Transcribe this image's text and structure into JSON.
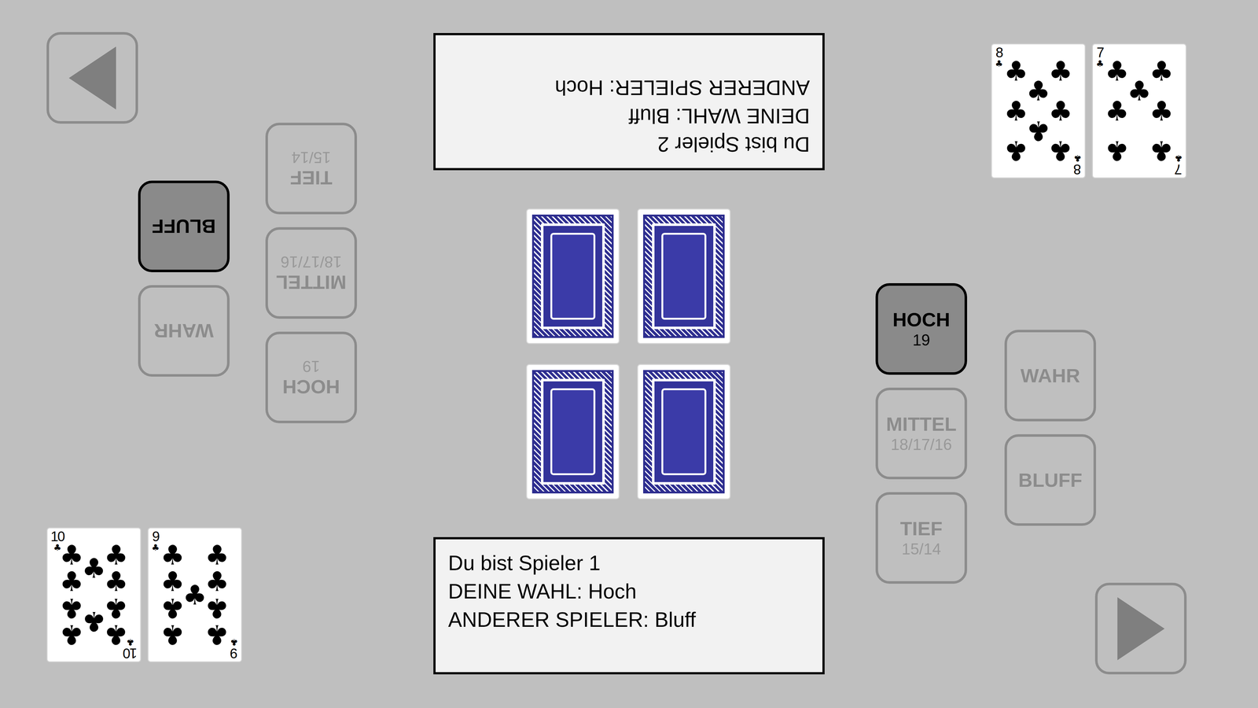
{
  "players": [
    {
      "status_lines": [
        "Du bist Spieler 1",
        "DEINE WAHL: Hoch",
        "ANDERER SPIELER: Bluff"
      ],
      "hand": [
        {
          "rank": "10",
          "suit": "♣"
        },
        {
          "rank": "9",
          "suit": "♣"
        }
      ],
      "range_buttons": [
        {
          "label": "HOCH",
          "values": "19",
          "selected": true
        },
        {
          "label": "MITTEL",
          "values": "18/17/16",
          "selected": false
        },
        {
          "label": "TIEF",
          "values": "15/14",
          "selected": false
        }
      ],
      "truth_buttons": [
        {
          "label": "WAHR",
          "selected": false
        },
        {
          "label": "BLUFF",
          "selected": false
        }
      ]
    },
    {
      "status_lines": [
        "Du bist Spieler 2",
        "DEINE WAHL: Bluff",
        "ANDERER SPIELER: Hoch"
      ],
      "hand": [
        {
          "rank": "8",
          "suit": "♣"
        },
        {
          "rank": "7",
          "suit": "♣"
        }
      ],
      "range_buttons": [
        {
          "label": "HOCH",
          "values": "19",
          "selected": false
        },
        {
          "label": "MITTEL",
          "values": "18/17/16",
          "selected": false
        },
        {
          "label": "TIEF",
          "values": "15/14",
          "selected": false
        }
      ],
      "truth_buttons": [
        {
          "label": "WAHR",
          "selected": false
        },
        {
          "label": "BLUFF",
          "selected": true
        }
      ]
    }
  ],
  "table_cards": [
    {
      "face_down": true
    },
    {
      "face_down": true
    },
    {
      "face_down": true
    },
    {
      "face_down": true
    }
  ]
}
